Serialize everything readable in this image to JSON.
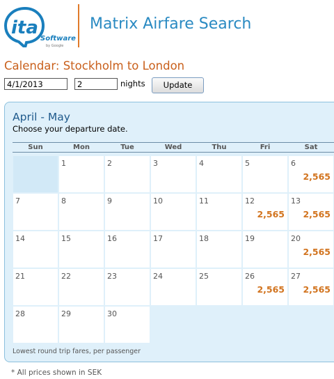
{
  "header": {
    "logo_text": "ita",
    "logo_subtext": "Software",
    "logo_byline": "by Google",
    "title": "Matrix Airfare Search"
  },
  "calendar_heading": "Calendar: Stockholm to London",
  "controls": {
    "date_value": "4/1/2013",
    "nights_value": "2",
    "nights_label": "nights",
    "update_label": "Update"
  },
  "calendar": {
    "month_range": "April - May",
    "instruction": "Choose your departure date.",
    "weekdays": [
      "Sun",
      "Mon",
      "Tue",
      "Wed",
      "Thu",
      "Fri",
      "Sat"
    ],
    "weeks": [
      [
        {
          "day": "",
          "fare": ""
        },
        {
          "day": "1",
          "fare": ""
        },
        {
          "day": "2",
          "fare": ""
        },
        {
          "day": "3",
          "fare": ""
        },
        {
          "day": "4",
          "fare": ""
        },
        {
          "day": "5",
          "fare": ""
        },
        {
          "day": "6",
          "fare": "2,565"
        }
      ],
      [
        {
          "day": "7",
          "fare": ""
        },
        {
          "day": "8",
          "fare": ""
        },
        {
          "day": "9",
          "fare": ""
        },
        {
          "day": "10",
          "fare": ""
        },
        {
          "day": "11",
          "fare": ""
        },
        {
          "day": "12",
          "fare": "2,565"
        },
        {
          "day": "13",
          "fare": "2,565"
        }
      ],
      [
        {
          "day": "14",
          "fare": ""
        },
        {
          "day": "15",
          "fare": ""
        },
        {
          "day": "16",
          "fare": ""
        },
        {
          "day": "17",
          "fare": ""
        },
        {
          "day": "18",
          "fare": ""
        },
        {
          "day": "19",
          "fare": ""
        },
        {
          "day": "20",
          "fare": "2,565"
        }
      ],
      [
        {
          "day": "21",
          "fare": ""
        },
        {
          "day": "22",
          "fare": ""
        },
        {
          "day": "23",
          "fare": ""
        },
        {
          "day": "24",
          "fare": ""
        },
        {
          "day": "25",
          "fare": ""
        },
        {
          "day": "26",
          "fare": "2,565"
        },
        {
          "day": "27",
          "fare": "2,565"
        }
      ],
      [
        {
          "day": "28",
          "fare": ""
        },
        {
          "day": "29",
          "fare": ""
        },
        {
          "day": "30",
          "fare": ""
        }
      ]
    ],
    "fares_note": "Lowest round trip fares, per passenger"
  },
  "footnote": "* All prices shown in SEK",
  "colors": {
    "accent_orange": "#d2741f",
    "brand_blue": "#2a8ac2",
    "panel_bg": "#dff0fa"
  },
  "icons": {
    "logo": "ita-software-logo"
  }
}
